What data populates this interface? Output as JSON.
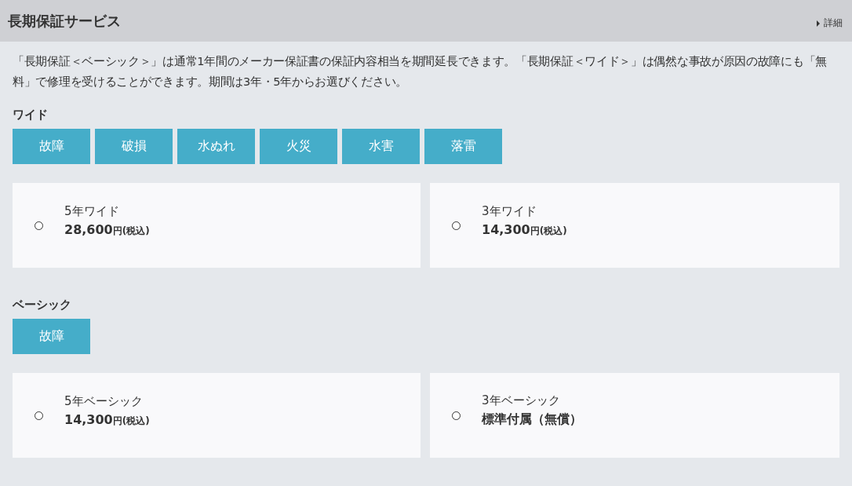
{
  "header": {
    "title": "長期保証サービス",
    "link": "詳細"
  },
  "description": "「長期保証＜ベーシック＞」は通常1年間のメーカー保証書の保証内容相当を期間延長できます。「長期保証＜ワイド＞」は偶然な事故が原因の故障にも「無料」で修理を受けることができます。期間は3年・5年からお選びください。",
  "sections": [
    {
      "title": "ワイド",
      "tags": [
        "故障",
        "破損",
        "水ぬれ",
        "火災",
        "水害",
        "落雷"
      ],
      "options": [
        {
          "name": "5年ワイド",
          "price": "28,600",
          "suffix": "円(税込)",
          "selected": false
        },
        {
          "name": "3年ワイド",
          "price": "14,300",
          "suffix": "円(税込)",
          "selected": false
        }
      ]
    },
    {
      "title": "ベーシック",
      "tags": [
        "故障"
      ],
      "options": [
        {
          "name": "5年ベーシック",
          "price": "14,300",
          "suffix": "円(税込)",
          "selected": false
        },
        {
          "name": "3年ベーシック",
          "price": "標準付属（無償）",
          "selected": false
        }
      ]
    }
  ]
}
